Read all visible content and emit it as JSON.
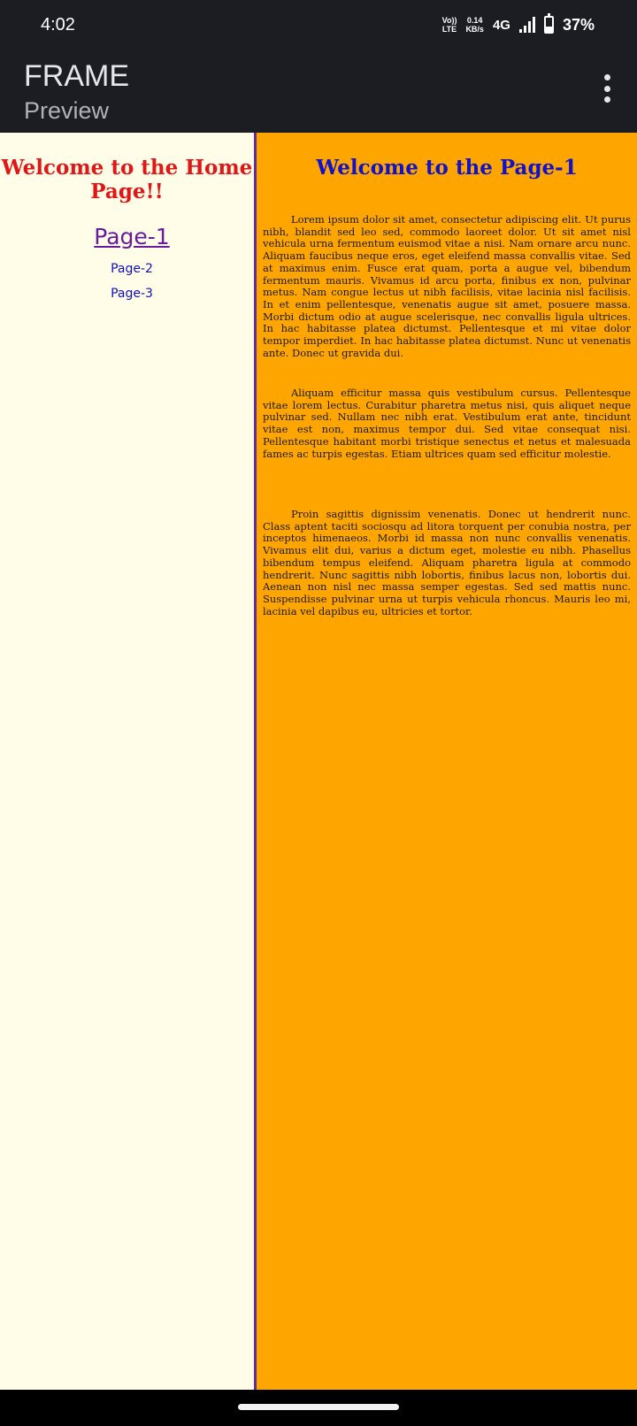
{
  "status_bar": {
    "time": "4:02",
    "volte_top": "Vo))",
    "volte_bottom": "LTE",
    "speed_value": "0.14",
    "speed_unit": "KB/s",
    "network": "4G",
    "battery_percent": "37%",
    "battery_level": 0.37,
    "icons": [
      "volte-icon",
      "signal-icon",
      "battery-icon"
    ]
  },
  "app_bar": {
    "title": "FRAME",
    "subtitle": "Preview",
    "menu_icon": "more-vert-icon"
  },
  "left_frame": {
    "heading": "Welcome to the Home Page!!",
    "links": [
      {
        "label": "Page-1"
      },
      {
        "label": "Page-2"
      },
      {
        "label": "Page-3"
      }
    ]
  },
  "right_frame": {
    "heading": "Welcome to the Page-1",
    "paragraphs": [
      "Lorem ipsum dolor sit amet, consectetur adipiscing elit. Ut purus nibh, blandit sed leo sed, commodo laoreet dolor. Ut sit amet nisl vehicula urna fermentum euismod vitae a nisi. Nam ornare arcu nunc. Aliquam faucibus neque eros, eget eleifend massa convallis vitae. Sed at maximus enim. Fusce erat quam, porta a augue vel, bibendum fermentum mauris. Vivamus id arcu porta, finibus ex non, pulvinar metus. Nam congue lectus ut nibh facilisis, vitae lacinia nisl facilisis. In et enim pellentesque, venenatis augue sit amet, posuere massa. Morbi dictum odio at augue scelerisque, nec convallis ligula ultrices. In hac habitasse platea dictumst. Pellentesque et mi vitae dolor tempor imperdiet. In hac habitasse platea dictumst. Nunc ut venenatis ante. Donec ut gravida dui.",
      "Aliquam efficitur massa quis vestibulum cursus. Pellentesque vitae lorem lectus. Curabitur pharetra metus nisi, quis aliquet neque pulvinar sed. Nullam nec nibh erat. Vestibulum erat ante, tincidunt vitae est non, maximus tempor dui. Sed vitae consequat nisi. Pellentesque habitant morbi tristique senectus et netus et malesuada fames ac turpis egestas. Etiam ultrices quam sed efficitur molestie.",
      "Proin sagittis dignissim venenatis. Donec ut hendrerit nunc. Class aptent taciti sociosqu ad litora torquent per conubia nostra, per inceptos himenaeos. Morbi id massa non nunc convallis venenatis. Vivamus elit dui, varius a dictum eget, molestie eu nibh. Phasellus bibendum tempus eleifend. Aliquam pharetra ligula at commodo hendrerit. Nunc sagittis nibh lobortis, finibus lacus non, lobortis dui. Aenean non nisl nec massa semper egestas. Sed sed mattis nunc. Suspendisse pulvinar urna ut turpis vehicula rhoncus. Mauris leo mi, lacinia vel dapibus eu, ultricies et tortor."
    ]
  },
  "colors": {
    "bars": "#1b1d23",
    "left_frame_bg": "#fffde7",
    "right_frame_bg": "#ffa500",
    "frame_border": "#6b2c8f",
    "home_heading": "#e11616",
    "page_heading": "#1212c8",
    "visited_link": "#6a1b9a",
    "link": "#1010c0"
  }
}
